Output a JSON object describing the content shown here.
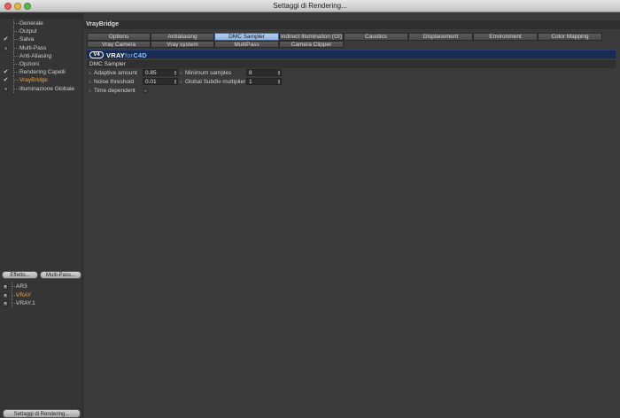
{
  "window": {
    "title": "Settaggi di Rendering..."
  },
  "sidebar": {
    "items": [
      {
        "label": "Generale",
        "checked": false,
        "checkbox": false,
        "active": false
      },
      {
        "label": "Output",
        "checked": false,
        "checkbox": false,
        "active": false
      },
      {
        "label": "Salva",
        "checked": true,
        "checkbox": true,
        "active": false
      },
      {
        "label": "Multi-Pass",
        "checked": false,
        "checkbox": true,
        "active": false
      },
      {
        "label": "Anti-Aliasing",
        "checked": false,
        "checkbox": false,
        "active": false
      },
      {
        "label": "Opzioni",
        "checked": false,
        "checkbox": false,
        "active": false
      },
      {
        "label": "Rendering Capelli",
        "checked": true,
        "checkbox": true,
        "active": false
      },
      {
        "label": "VrayBridge",
        "checked": true,
        "checkbox": true,
        "active": true
      },
      {
        "label": "Illuminazione Globale",
        "checked": false,
        "checkbox": true,
        "active": false
      }
    ],
    "effetto_button": "Effetto...",
    "multipass_button": "Multi-Pass...",
    "effects": [
      {
        "label": "AR3",
        "active": false
      },
      {
        "label": "VRAY",
        "active": true
      },
      {
        "label": "VRAY.1",
        "active": false
      }
    ],
    "render_settings_button": "Settaggi di Rendering..."
  },
  "panel": {
    "title": "VrayBridge",
    "tabs_row1": [
      "Options",
      "Antialiasing",
      "DMC Sampler",
      "Indirect Illumination (GI)",
      "Caustics",
      "Displacement",
      "Environment",
      "Color Mapping"
    ],
    "tabs_row2": [
      "Vray Camera",
      "Vray system",
      "MultiPass",
      "Camera Clipper"
    ],
    "selected_tab": "DMC Sampler",
    "logo": {
      "mark": "V4",
      "vray": "VRAY",
      "for": "for",
      "c4d": "C4D"
    },
    "section_title": "DMC Sampler",
    "params": {
      "adaptive_amount": {
        "label": "Adaptive amount",
        "value": "0.85"
      },
      "noise_threshold": {
        "label": "Noise threshold",
        "value": "0.01"
      },
      "time_dependent": {
        "label": "Time dependent",
        "checked": false
      },
      "minimum_samples": {
        "label": "Minimum samples",
        "value": "8"
      },
      "global_subdiv": {
        "label": "Global Subdiv multiplier",
        "value": "1"
      }
    }
  },
  "colors": {
    "accent_active": "#f2a33a",
    "tab_selected": "#8fb3de",
    "banner": "#182b52"
  }
}
